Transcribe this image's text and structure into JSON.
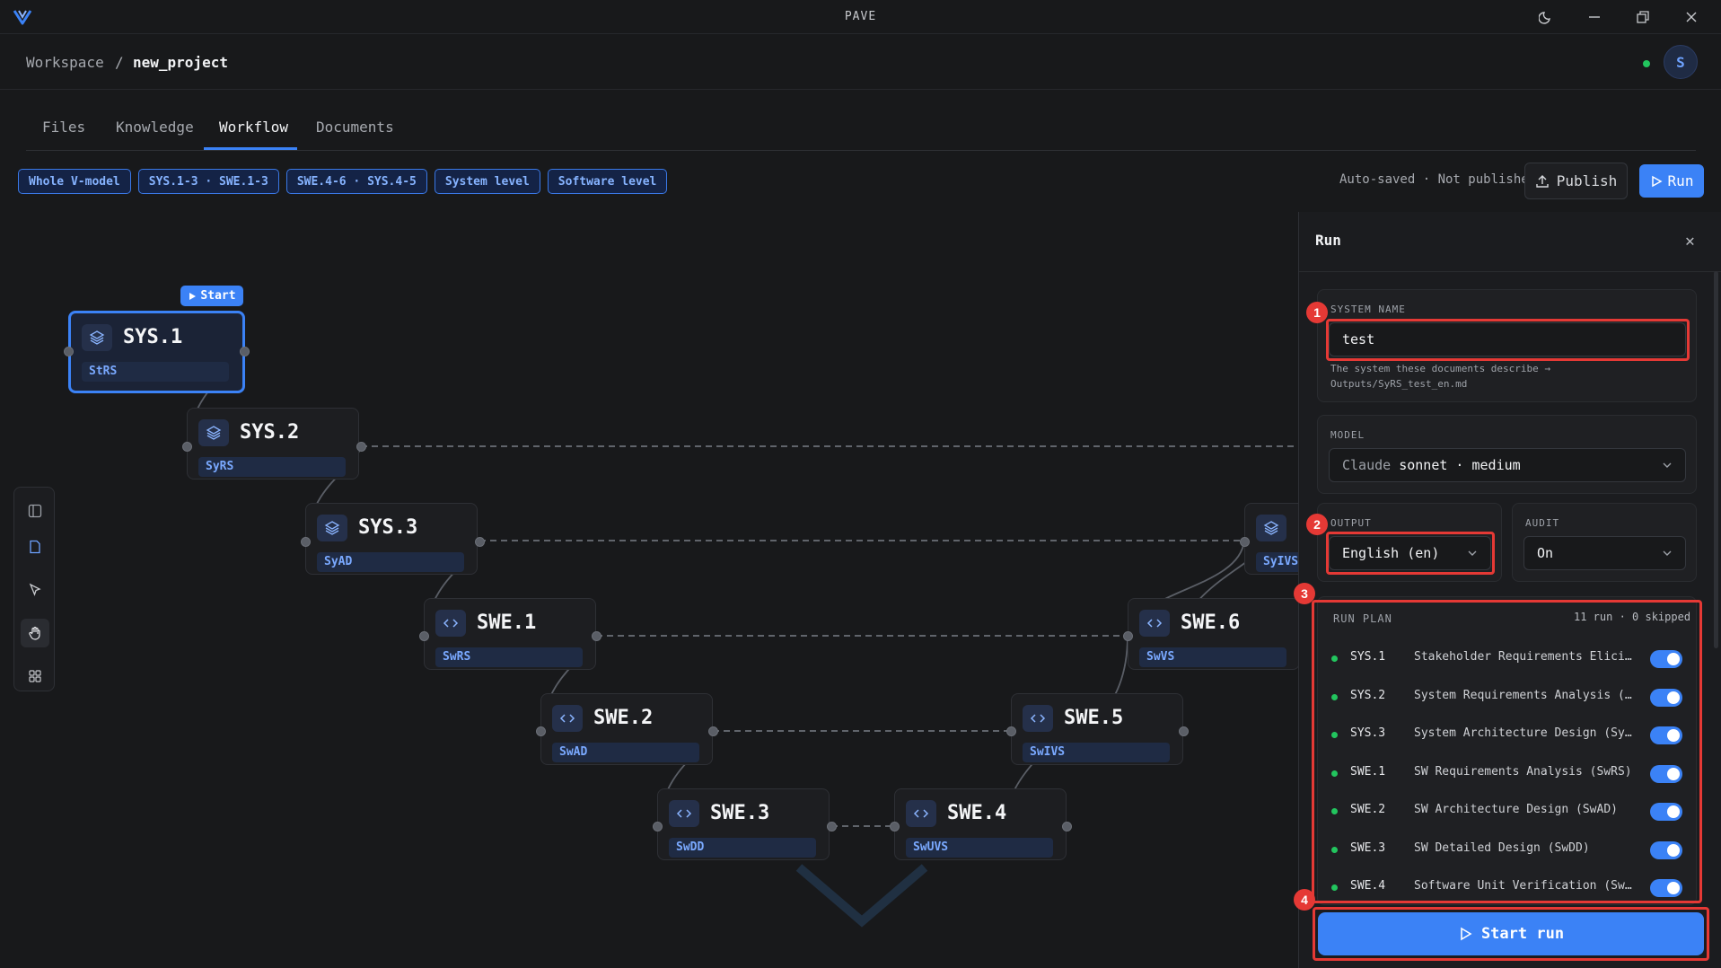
{
  "app": {
    "title": "PAVE"
  },
  "breadcrumb": {
    "root": "Workspace",
    "separator": "/",
    "current": "new_project"
  },
  "user": {
    "avatar_initial": "S",
    "status": "online"
  },
  "tabs": [
    {
      "label": "Files"
    },
    {
      "label": "Knowledge"
    },
    {
      "label": "Workflow",
      "active": true
    },
    {
      "label": "Documents"
    }
  ],
  "scope_chips": [
    "Whole V-model",
    "SYS.1-3 · SWE.1-3",
    "SWE.4-6 · SYS.4-5",
    "System level",
    "Software level"
  ],
  "toolbar": {
    "status": "Auto-saved · Not published",
    "publish_label": "Publish",
    "run_label": "Run"
  },
  "canvas": {
    "start_badge": "Start",
    "nodes": [
      {
        "id": "SYS.1",
        "doc": "StRS",
        "icon": "layers-icon"
      },
      {
        "id": "SYS.2",
        "doc": "SyRS",
        "icon": "layers-icon"
      },
      {
        "id": "SYS.3",
        "doc": "SyAD",
        "icon": "layers-icon"
      },
      {
        "id": "SWE.1",
        "doc": "SwRS",
        "icon": "code-icon"
      },
      {
        "id": "SWE.2",
        "doc": "SwAD",
        "icon": "code-icon"
      },
      {
        "id": "SWE.3",
        "doc": "SwDD",
        "icon": "code-icon"
      },
      {
        "id": "SWE.4",
        "doc": "SwUVS",
        "icon": "code-icon"
      },
      {
        "id": "SWE.5",
        "doc": "SwIVS",
        "icon": "code-icon"
      },
      {
        "id": "SWE.6",
        "doc": "SwVS",
        "icon": "code-icon"
      },
      {
        "id": "",
        "doc": "SyIVS",
        "icon": "layers-icon"
      }
    ]
  },
  "run_panel": {
    "title": "Run",
    "system_name": {
      "label": "SYSTEM NAME",
      "value": "test",
      "help": "The system these documents describe →",
      "help_path": "Outputs/SyRS_test_en.md"
    },
    "model": {
      "label": "MODEL",
      "provider": "Claude",
      "value": "sonnet · medium"
    },
    "output": {
      "label": "OUTPUT",
      "value": "English (en)"
    },
    "audit": {
      "label": "AUDIT",
      "value": "On"
    },
    "plan": {
      "label": "RUN PLAN",
      "summary": "11 run · 0 skipped",
      "items": [
        {
          "id": "SYS.1",
          "name": "Stakeholder Requirements Elicitat…",
          "enabled": true
        },
        {
          "id": "SYS.2",
          "name": "System Requirements Analysis (SyR…",
          "enabled": true
        },
        {
          "id": "SYS.3",
          "name": "System Architecture Design (SyAD)",
          "enabled": true
        },
        {
          "id": "SWE.1",
          "name": "SW Requirements Analysis (SwRS)",
          "enabled": true
        },
        {
          "id": "SWE.2",
          "name": "SW Architecture Design (SwAD)",
          "enabled": true
        },
        {
          "id": "SWE.3",
          "name": "SW Detailed Design (SwDD)",
          "enabled": true
        },
        {
          "id": "SWE.4",
          "name": "Software Unit Verification (SwUVS)",
          "enabled": true
        }
      ]
    },
    "start_label": "Start run"
  },
  "annotations": [
    "1",
    "2",
    "3",
    "4"
  ],
  "colors": {
    "accent": "#3b82f6",
    "annotation": "#e53935",
    "ok": "#22c55e",
    "bg": "#18191b"
  }
}
